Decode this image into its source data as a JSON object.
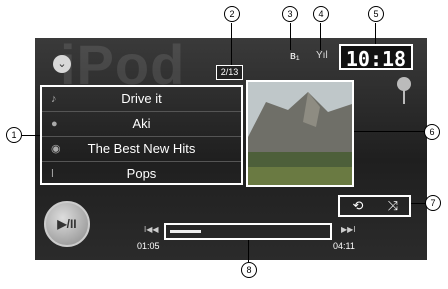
{
  "source_label": "iPod",
  "track_count": "2/13",
  "status": {
    "bluetooth": "ʙ₁",
    "signal": "Yıl"
  },
  "clock": "10:18",
  "track_info": [
    {
      "icon": "music-note-icon",
      "glyph": "♪",
      "text": "Drive it"
    },
    {
      "icon": "artist-icon",
      "glyph": "●",
      "text": "Aki"
    },
    {
      "icon": "album-icon",
      "glyph": "◉",
      "text": "The Best New Hits"
    },
    {
      "icon": "genre-icon",
      "glyph": "ǀ",
      "text": "Pops"
    }
  ],
  "controls": {
    "play_pause": "▶/II",
    "repeat": "⟲",
    "shuffle": "⤨",
    "prev": "I◀◀",
    "next": "▶▶I"
  },
  "progress": {
    "elapsed": "01:05",
    "total": "04:11",
    "fraction": 0.2
  },
  "callouts": [
    "1",
    "2",
    "3",
    "4",
    "5",
    "6",
    "7",
    "8"
  ]
}
